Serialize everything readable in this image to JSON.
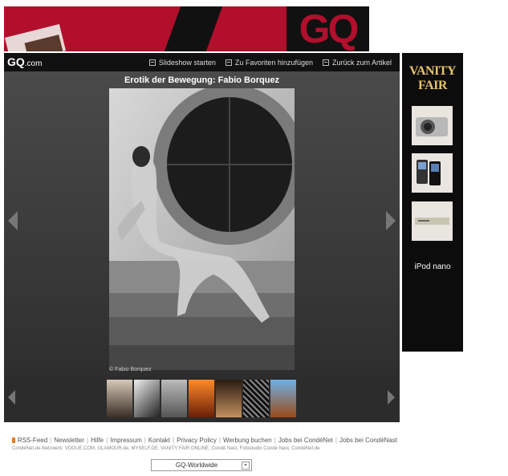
{
  "banner": {
    "logo": "GQ"
  },
  "header": {
    "brand": "GQ",
    "brand_suffix": ".com",
    "links": [
      "Slideshow starten",
      "Zu Favoriten hinzufügen",
      "Zurück zum Artikel"
    ]
  },
  "gallery": {
    "title": "Erotik der Bewegung: Fabio Borquez",
    "caption": "© Fabio Borquez"
  },
  "ad": {
    "brand": "VANITY FAIR",
    "tagline": "iPod nano"
  },
  "footer": {
    "links": [
      "RSS-Feed",
      "Newsletter",
      "Hilfe",
      "Impressum",
      "Kontakt",
      "Privacy Policy",
      "Werbung buchen",
      "Jobs bei CondéNet",
      "Jobs bei CondéNast"
    ],
    "network": "CondéNet.de-Netzwerk:  VOGUE.COM,  GLAMOUR.de,  MYSELF.DE,  VANITY FAIR ONLINE,  Condé Nast,  Fotostudio Condé Nast,  CondéNet.de",
    "select_value": "GQ-Worldwide"
  },
  "colors": {
    "banner_red": "#b10f2c",
    "panel_bg": "#3a3a3a",
    "vf_gold": "#e6c36d"
  }
}
